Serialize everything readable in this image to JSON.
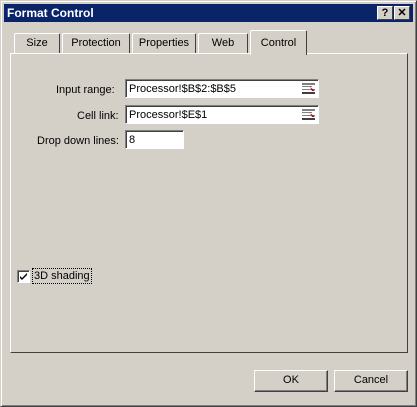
{
  "window": {
    "title": "Format Control",
    "help_glyph": "?",
    "close_glyph": "✕"
  },
  "tabs": [
    {
      "label": "Size",
      "active": false
    },
    {
      "label": "Protection",
      "active": false
    },
    {
      "label": "Properties",
      "active": false
    },
    {
      "label": "Web",
      "active": false
    },
    {
      "label": "Control",
      "active": true
    }
  ],
  "control": {
    "input_range": {
      "label": "Input range:",
      "value": "Processor!$B$2:$B$5"
    },
    "cell_link": {
      "label": "Cell link:",
      "value": "Processor!$E$1"
    },
    "drop_down_lines": {
      "label": "Drop down lines:",
      "value": "8"
    },
    "shading": {
      "label": "3D shading",
      "checked": true
    }
  },
  "buttons": {
    "ok": "OK",
    "cancel": "Cancel"
  },
  "icons": {
    "ref_button": "collapse-dialog-icon",
    "check": "check-icon"
  }
}
